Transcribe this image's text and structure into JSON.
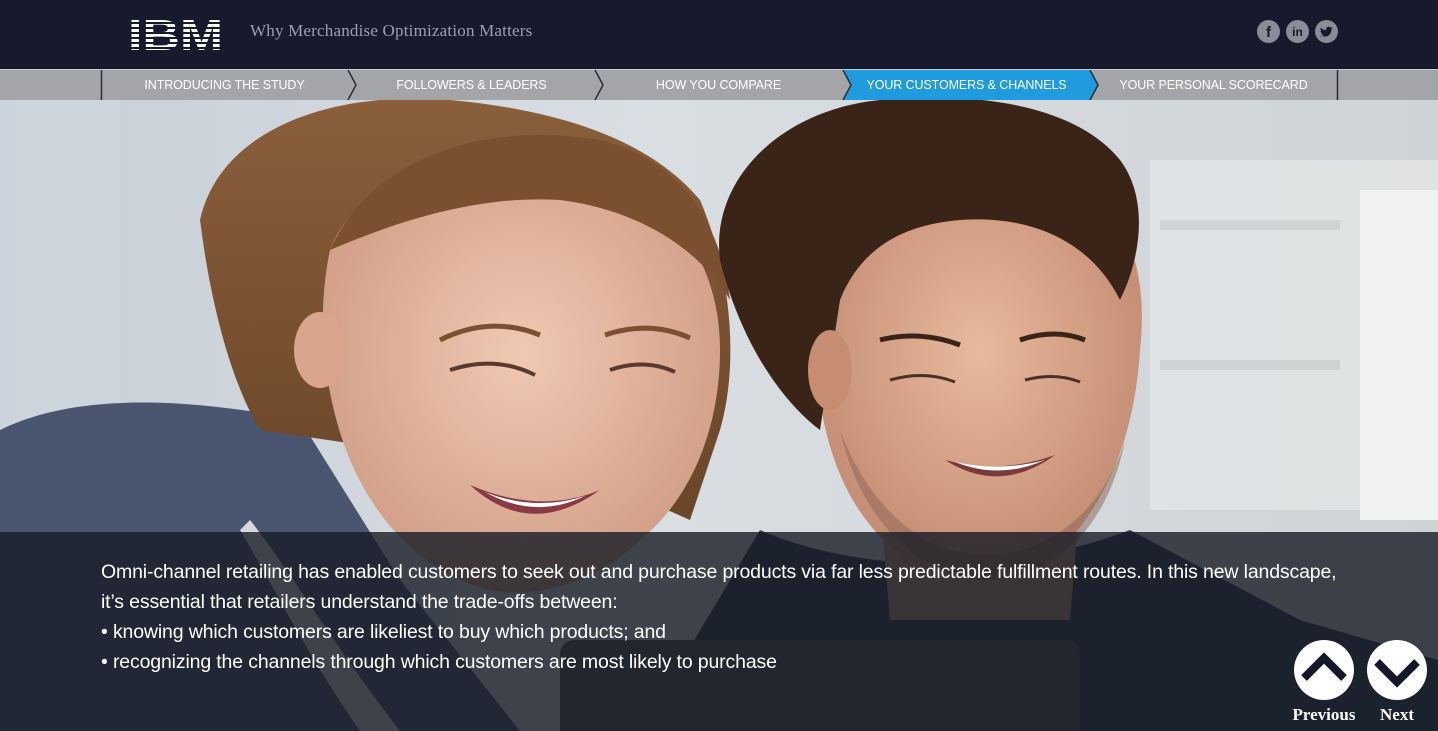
{
  "header": {
    "logo_text": "IBM",
    "title": "Why Merchandise Optimization Matters",
    "social": [
      {
        "icon": "facebook-icon",
        "glyph": "f"
      },
      {
        "icon": "linkedin-icon",
        "glyph": "in"
      },
      {
        "icon": "twitter-icon",
        "glyph": "t"
      }
    ]
  },
  "nav": {
    "items": [
      {
        "label": "INTRODUCING THE STUDY",
        "active": false
      },
      {
        "label": "FOLLOWERS & LEADERS",
        "active": false
      },
      {
        "label": "HOW YOU COMPARE",
        "active": false
      },
      {
        "label": "YOUR CUSTOMERS & CHANNELS",
        "active": true
      },
      {
        "label": "YOUR PERSONAL SCORECARD",
        "active": false
      }
    ],
    "active_color": "#1f9bde"
  },
  "caption": {
    "intro": "Omni-channel retailing has enabled customers to seek out and purchase products via far less predictable fulfillment routes. In this new landscape, it’s essential that retailers understand the trade-offs between:",
    "bullets": [
      "• knowing which customers are likeliest to buy which products; and",
      "• recognizing the channels through which customers are most likely to purchase"
    ]
  },
  "pager": {
    "previous_label": "Previous",
    "next_label": "Next"
  },
  "colors": {
    "header_bg": "#161a2c",
    "nav_bg": "#a3a5a8",
    "accent": "#1f9bde"
  }
}
